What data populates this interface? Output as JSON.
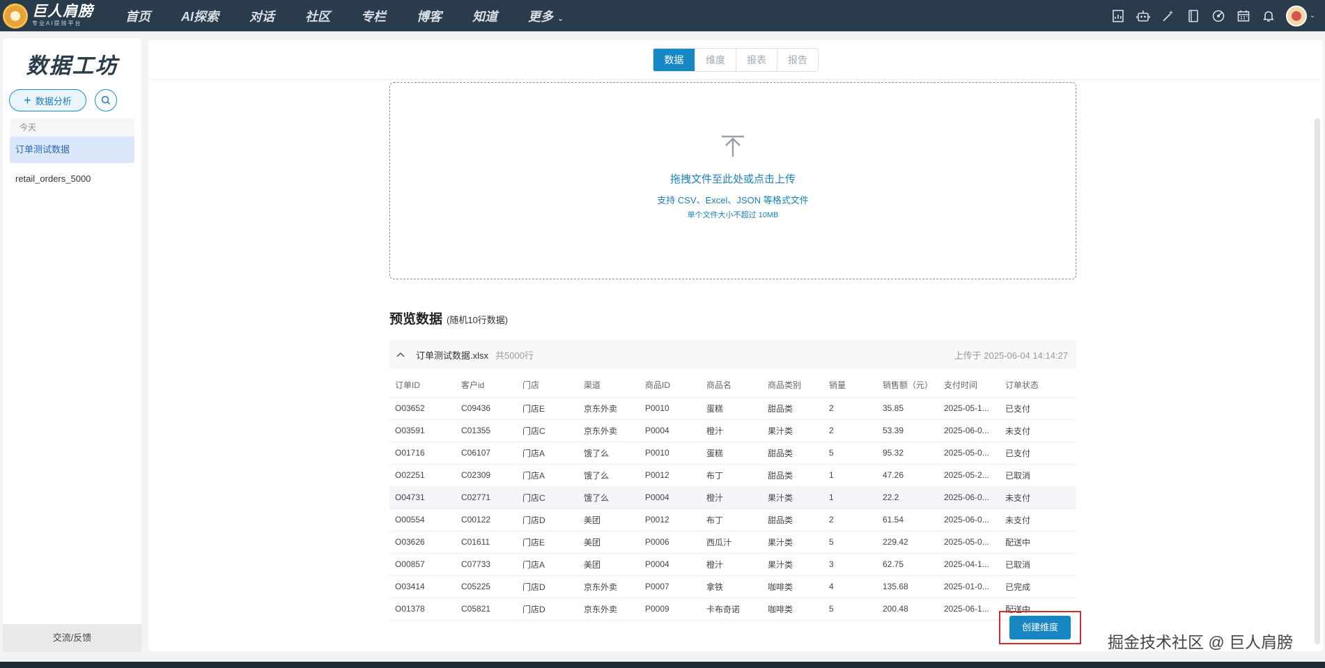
{
  "brand": {
    "title": "巨人肩膀",
    "subtitle": "专业AI提效平台"
  },
  "nav": {
    "items": [
      "首页",
      "AI探索",
      "对话",
      "社区",
      "专栏",
      "博客",
      "知道"
    ],
    "more": "更多"
  },
  "nav_icons": [
    "report-icon",
    "robot-icon",
    "magic-wand-icon",
    "notebook-icon",
    "chart-circle-icon",
    "calendar-icon",
    "bell-icon"
  ],
  "sidebar": {
    "title": "数据工坊",
    "analyze_label": "数据分析",
    "group_label": "今天",
    "items": [
      "订单测试数据",
      "retail_orders_5000"
    ],
    "footer": "交流/反馈"
  },
  "tabs": [
    "数据",
    "维度",
    "报表",
    "报告"
  ],
  "upload": {
    "main": "拖拽文件至此处或点击上传",
    "formats": "支持 CSV、Excel、JSON 等格式文件",
    "limit": "单个文件大小不超过 10MB"
  },
  "preview": {
    "title": "预览数据",
    "subtitle": "(随机10行数据)",
    "file_name": "订单测试数据.xlsx",
    "row_count": "共5000行",
    "uploaded_at": "上传于 2025-06-04 14:14:27"
  },
  "table": {
    "columns": [
      "订单ID",
      "客户id",
      "门店",
      "渠道",
      "商品ID",
      "商品名",
      "商品类别",
      "销量",
      "销售额（元）",
      "支付时间",
      "订单状态"
    ],
    "rows": [
      [
        "O03652",
        "C09436",
        "门店E",
        "京东外卖",
        "P0010",
        "蛋糕",
        "甜品类",
        "2",
        "35.85",
        "2025-05-1...",
        "已支付"
      ],
      [
        "O03591",
        "C01355",
        "门店C",
        "京东外卖",
        "P0004",
        "橙汁",
        "果汁类",
        "2",
        "53.39",
        "2025-06-0...",
        "未支付"
      ],
      [
        "O01716",
        "C06107",
        "门店A",
        "饿了么",
        "P0010",
        "蛋糕",
        "甜品类",
        "5",
        "95.32",
        "2025-05-0...",
        "已支付"
      ],
      [
        "O02251",
        "C02309",
        "门店A",
        "饿了么",
        "P0012",
        "布丁",
        "甜品类",
        "1",
        "47.26",
        "2025-05-2...",
        "已取消"
      ],
      [
        "O04731",
        "C02771",
        "门店C",
        "饿了么",
        "P0004",
        "橙汁",
        "果汁类",
        "1",
        "22.2",
        "2025-06-0...",
        "未支付"
      ],
      [
        "O00554",
        "C00122",
        "门店D",
        "美团",
        "P0012",
        "布丁",
        "甜品类",
        "2",
        "61.54",
        "2025-06-0...",
        "未支付"
      ],
      [
        "O03626",
        "C01611",
        "门店E",
        "美团",
        "P0006",
        "西瓜汁",
        "果汁类",
        "5",
        "229.42",
        "2025-05-0...",
        "配送中"
      ],
      [
        "O00857",
        "C07733",
        "门店A",
        "美团",
        "P0004",
        "橙汁",
        "果汁类",
        "3",
        "62.75",
        "2025-04-1...",
        "已取消"
      ],
      [
        "O03414",
        "C05225",
        "门店D",
        "京东外卖",
        "P0007",
        "拿铁",
        "咖啡类",
        "4",
        "135.68",
        "2025-01-0...",
        "已完成"
      ],
      [
        "O01378",
        "C05821",
        "门店D",
        "京东外卖",
        "P0009",
        "卡布奇诺",
        "咖啡类",
        "5",
        "200.48",
        "2025-06-1...",
        "配送中"
      ]
    ]
  },
  "create_button": "创建维度",
  "watermark": "掘金技术社区 @ 巨人肩膀",
  "colors": {
    "nav_bg": "#2a3b4c",
    "accent": "#1787c3",
    "highlight_border": "#d22b2b"
  }
}
